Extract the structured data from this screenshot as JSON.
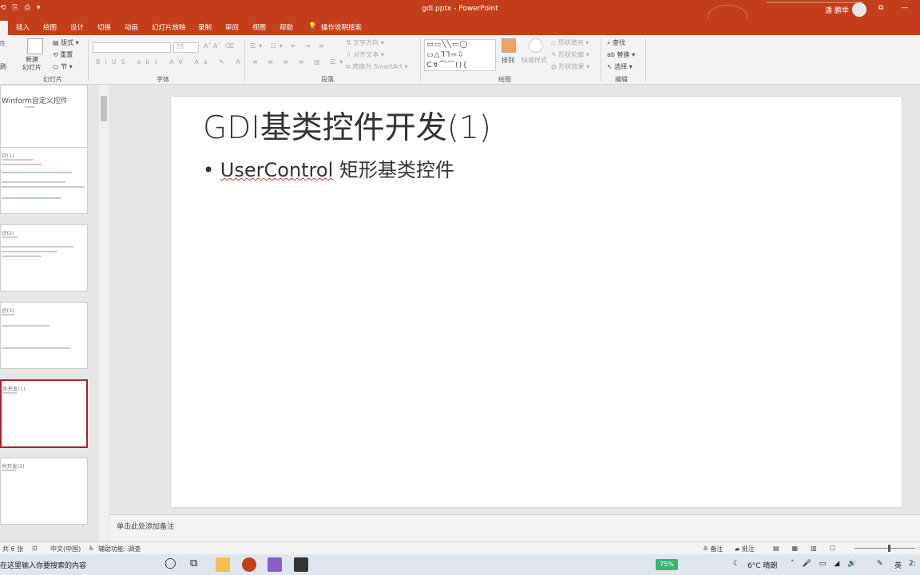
{
  "titlebar": {
    "quick_access": [
      "⟲",
      "⎘",
      "⎙",
      "▾",
      "₹"
    ],
    "title": "gdi.pptx  -  PowerPoint",
    "user": "潘 鹏举",
    "controls": [
      "⧉",
      "—"
    ]
  },
  "tabs": [
    "插入",
    "绘图",
    "设计",
    "切换",
    "动画",
    "幻灯片放映",
    "录制",
    "审阅",
    "视图",
    "帮助"
  ],
  "tell_me": "操作说明搜索",
  "ribbon": {
    "slides": {
      "layout": "版式",
      "reset": "重置",
      "section": "节",
      "new_slide": "新建\n幻灯片",
      "group": "幻灯片"
    },
    "font": {
      "size": "28",
      "group": "字体"
    },
    "paragraph": {
      "text_direction": "文字方向",
      "align_text": "对齐文本",
      "smartart": "转换为 SmartArt",
      "group": "段落"
    },
    "drawing": {
      "arrange": "排列",
      "quick_styles": "快速样式",
      "fill": "形状填充",
      "outline": "形状轮廓",
      "effects": "形状效果",
      "group": "绘图"
    },
    "editing": {
      "find": "查找",
      "replace": "替换",
      "select": "选择",
      "group": "编辑"
    }
  },
  "thumbnails": [
    {
      "title": "Winform自定义控件"
    },
    {
      "title": "识(1)"
    },
    {
      "title": "识(2)"
    },
    {
      "title": "识(3)"
    },
    {
      "title": "件开发(1)"
    },
    {
      "title": "件开发(2)"
    }
  ],
  "slide": {
    "title": "GDI基类控件开发(1)",
    "bullet_prefix": "• ",
    "bullet_sq": "UserControl",
    "bullet_rest": " 矩形基类控件"
  },
  "notes_placeholder": "单击此处添加备注",
  "status": {
    "slide_count": "共 6 张",
    "language": "中文(中国)",
    "accessibility": "辅助功能: 调查",
    "notes": "备注",
    "comments": "批注"
  },
  "taskbar": {
    "search": "在这里输入你要搜索的内容",
    "battery": "75%",
    "weather": "6°C  晴朗",
    "ime": "英",
    "clock": "2:"
  },
  "colors": {
    "accent": "#c43e1c",
    "selected_border": "#a4262c"
  }
}
